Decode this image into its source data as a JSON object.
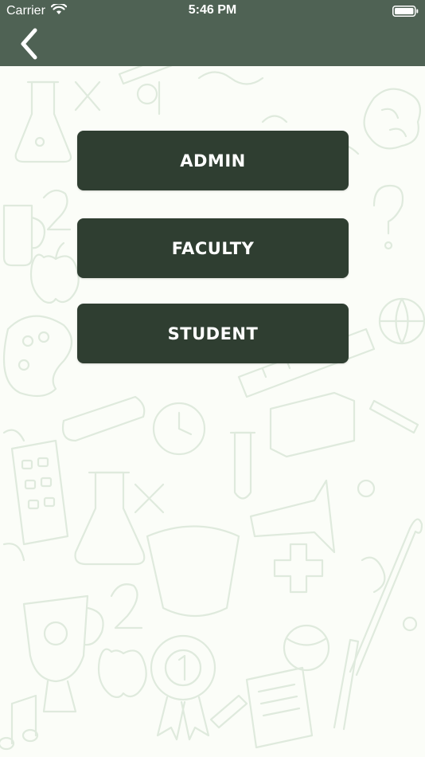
{
  "status_bar": {
    "carrier": "Carrier",
    "time": "5:46 PM",
    "wifi_icon": "wifi-icon",
    "battery_icon": "battery-icon"
  },
  "nav_bar": {
    "back_icon": "chevron-left-icon"
  },
  "roles": {
    "admin_label": "ADMIN",
    "faculty_label": "FACULTY",
    "student_label": "STUDENT"
  },
  "colors": {
    "header_bg": "#4f6254",
    "button_bg": "#2f3e31",
    "button_text": "#ffffff",
    "page_bg": "#fbfdf8",
    "doodle_stroke": "#dfeadd"
  }
}
